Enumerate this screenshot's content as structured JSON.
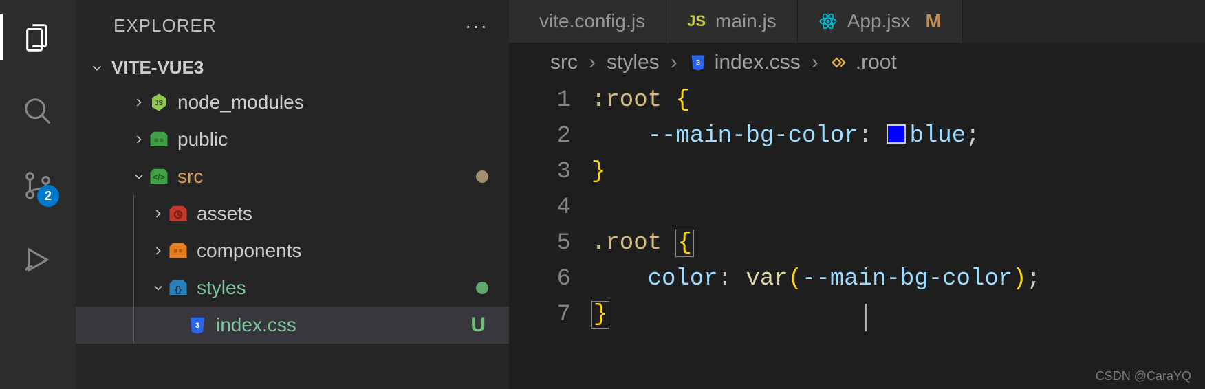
{
  "activity": {
    "explorer_active": true,
    "source_control_badge": "2"
  },
  "sidebar": {
    "title": "EXPLORER",
    "more_label": "···",
    "project_name": "VITE-VUE3",
    "tree": [
      {
        "type": "folder",
        "label": "node_modules",
        "expanded": false,
        "depth": 1,
        "icon": "nodejs"
      },
      {
        "type": "folder",
        "label": "public",
        "expanded": false,
        "depth": 1,
        "icon": "public"
      },
      {
        "type": "folder",
        "label": "src",
        "expanded": true,
        "depth": 1,
        "icon": "src",
        "modified": true,
        "color": "orange"
      },
      {
        "type": "folder",
        "label": "assets",
        "expanded": false,
        "depth": 2,
        "icon": "assets"
      },
      {
        "type": "folder",
        "label": "components",
        "expanded": false,
        "depth": 2,
        "icon": "components"
      },
      {
        "type": "folder",
        "label": "styles",
        "expanded": true,
        "depth": 2,
        "icon": "styles",
        "modified_green": true,
        "color": "green"
      },
      {
        "type": "file",
        "label": "index.css",
        "depth": 3,
        "icon": "css",
        "status": "U",
        "color": "green",
        "active": true
      }
    ]
  },
  "tabs": [
    {
      "label": "vite.config.js",
      "truncated": "vite.config.js",
      "icon": "js"
    },
    {
      "label": "main.js",
      "icon": "js",
      "icon_text": "JS"
    },
    {
      "label": "App.jsx",
      "icon": "react",
      "modified": "M"
    }
  ],
  "breadcrumbs": {
    "parts": [
      "src",
      "styles",
      "index.css",
      ".root"
    ],
    "file_icon": "css",
    "symbol_icon": "rule"
  },
  "code": {
    "lines": [
      {
        "n": "1",
        "segs": [
          {
            "t": ":root ",
            "c": "tok-sel"
          },
          {
            "t": "{",
            "c": "tok-brace"
          }
        ]
      },
      {
        "n": "2",
        "segs": [
          {
            "t": "    ",
            "c": ""
          },
          {
            "t": "--main-bg-color",
            "c": "tok-var"
          },
          {
            "t": ": ",
            "c": "tok-punct"
          },
          {
            "swatch": true
          },
          {
            "t": "blue",
            "c": "tok-prop"
          },
          {
            "t": ";",
            "c": "tok-punct"
          }
        ]
      },
      {
        "n": "3",
        "segs": [
          {
            "t": "}",
            "c": "tok-brace"
          }
        ]
      },
      {
        "n": "4",
        "segs": []
      },
      {
        "n": "5",
        "segs": [
          {
            "t": ".root ",
            "c": "tok-sel"
          },
          {
            "t": "{",
            "c": "tok-brace brace-box"
          }
        ]
      },
      {
        "n": "6",
        "segs": [
          {
            "t": "    ",
            "c": ""
          },
          {
            "t": "color",
            "c": "tok-prop"
          },
          {
            "t": ": ",
            "c": "tok-punct"
          },
          {
            "t": "var",
            "c": "tok-func"
          },
          {
            "t": "(",
            "c": "tok-brace"
          },
          {
            "t": "--main-bg-color",
            "c": "tok-var"
          },
          {
            "t": ")",
            "c": "tok-brace"
          },
          {
            "t": ";",
            "c": "tok-punct"
          }
        ]
      },
      {
        "n": "7",
        "segs": [
          {
            "t": "}",
            "c": "tok-brace brace-box"
          }
        ]
      }
    ]
  },
  "watermark": "CSDN @CaraYQ"
}
